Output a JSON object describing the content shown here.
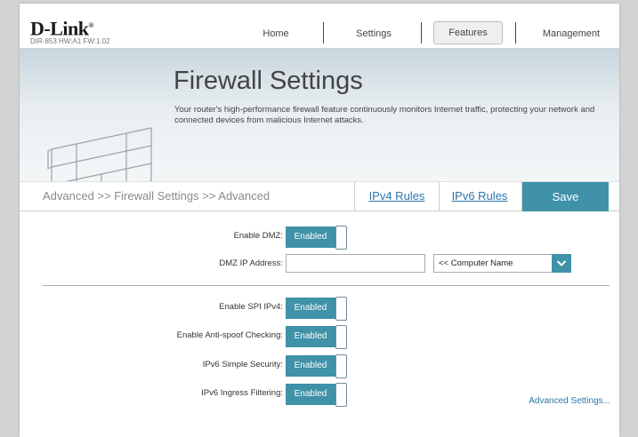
{
  "header": {
    "brand": "D-Link",
    "brand_mark": "®",
    "model": "DIR-853 HW:A1 FW:1.02",
    "nav": {
      "home": "Home",
      "settings": "Settings",
      "features": "Features",
      "management": "Management"
    },
    "active_nav": "Features"
  },
  "banner": {
    "title": "Firewall Settings",
    "description": "Your router's high-performance firewall feature continuously monitors Internet traffic, protecting your network and connected devices from malicious Internet attacks."
  },
  "tabbar": {
    "breadcrumb": "Advanced >> Firewall Settings >> Advanced",
    "tab_ipv4": "IPv4 Rules",
    "tab_ipv6": "IPv6 Rules",
    "save": "Save"
  },
  "form": {
    "dmz": {
      "label": "Enable DMZ:",
      "state": "Enabled"
    },
    "dmz_ip": {
      "label": "DMZ IP Address:",
      "value": "",
      "select_value": "<< Computer Name"
    },
    "spi": {
      "label": "Enable SPI IPv4:",
      "state": "Enabled"
    },
    "antispoof": {
      "label": "Enable Anti-spoof Checking:",
      "state": "Enabled"
    },
    "ipv6_simple": {
      "label": "IPv6 Simple Security:",
      "state": "Enabled"
    },
    "ipv6_ingress": {
      "label": "IPv6 Ingress Filtering:",
      "state": "Enabled"
    }
  },
  "advanced_link": "Advanced Settings...",
  "colors": {
    "accent": "#3f92a8",
    "link": "#2b77a8",
    "page_bg": "#d2d3d4"
  },
  "icons": {
    "banner_graphic": "brick-wall-icon",
    "select_arrow": "chevron-down-icon"
  }
}
